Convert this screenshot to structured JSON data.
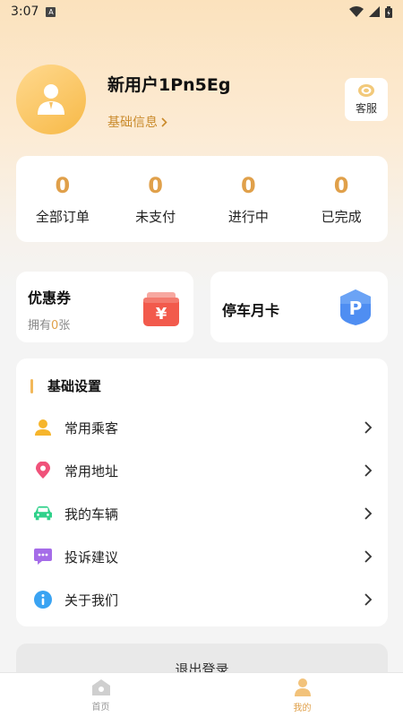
{
  "status_bar": {
    "time": "3:07",
    "notification_badge": "A"
  },
  "profile": {
    "username": "新用户1Pn5Eg",
    "basic_info_link": "基础信息",
    "service_label": "客服"
  },
  "orders": [
    {
      "count": "0",
      "label": "全部订单"
    },
    {
      "count": "0",
      "label": "未支付"
    },
    {
      "count": "0",
      "label": "进行中"
    },
    {
      "count": "0",
      "label": "已完成"
    }
  ],
  "coupon": {
    "title": "优惠券",
    "sub_prefix": "拥有",
    "count": "0",
    "sub_suffix": "张",
    "icon_glyph": "¥"
  },
  "parking": {
    "title": "停车月卡",
    "icon_glyph": "P"
  },
  "settings": {
    "title": "基础设置",
    "items": [
      {
        "label": "常用乘客",
        "icon": "passenger-icon"
      },
      {
        "label": "常用地址",
        "icon": "location-pin-icon"
      },
      {
        "label": "我的车辆",
        "icon": "car-icon"
      },
      {
        "label": "投诉建议",
        "icon": "chat-bubble-icon"
      },
      {
        "label": "关于我们",
        "icon": "info-icon"
      }
    ]
  },
  "logout_label": "退出登录",
  "tabs": [
    {
      "label": "首页",
      "active": false
    },
    {
      "label": "我的",
      "active": true
    }
  ],
  "colors": {
    "accent": "#e0a04a",
    "gradient_top": "#fbe2bd",
    "page_bg": "#f4f4f4"
  }
}
